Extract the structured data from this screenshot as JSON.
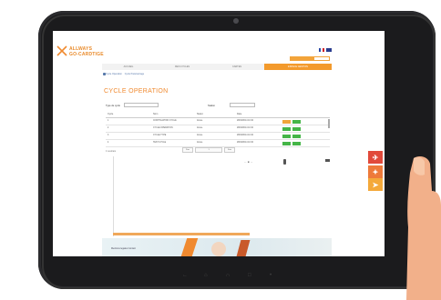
{
  "brand": {
    "name_line1": "ALLWAYS",
    "name_line2": "GO-CARDTIGE",
    "primary_color": "#f08a30",
    "accent_color": "#44b547"
  },
  "header": {
    "languages": [
      "FR",
      "EN"
    ]
  },
  "nav": {
    "tabs": [
      {
        "label": "ACCUEIL"
      },
      {
        "label": "MES CYCLES"
      },
      {
        "label": "CARTES"
      },
      {
        "label": "ESPACE GESTION"
      }
    ],
    "active_index": 3
  },
  "sublinks": {
    "items": [
      "Cycle Operation",
      "Cycle Parametrage"
    ]
  },
  "page": {
    "title": "CYCLE OPERATION"
  },
  "filters": {
    "filter1_label": "Type de cycle",
    "filter1_value": "",
    "filter2_label": "Station",
    "filter2_value": ""
  },
  "table": {
    "headers": [
      "Cycle",
      "Nom",
      "Statut",
      "Date"
    ],
    "rows": [
      {
        "cycle": "1",
        "name": "CONTINUATION CYCLE",
        "status": "Arrete",
        "date": "28/03/2014 10:32"
      },
      {
        "cycle": "2",
        "name": "CYCLE OPERATION",
        "status": "Arrete",
        "date": "28/03/2014 10:32"
      },
      {
        "cycle": "3",
        "name": "CYCLE TYPE",
        "status": "Arrete",
        "date": "28/03/2014 10:32"
      },
      {
        "cycle": "4",
        "name": "TEST CYCLE",
        "status": "Arrete",
        "date": "28/03/2014 10:32"
      }
    ]
  },
  "footer": {
    "count_text": "4 resultats",
    "pager": [
      "Prec",
      "1",
      "Suiv"
    ],
    "links": "Mentions legales   Contact"
  },
  "icons": {
    "fab1": "plane-icon",
    "fab2": "person-icon",
    "fab3": "route-icon"
  }
}
